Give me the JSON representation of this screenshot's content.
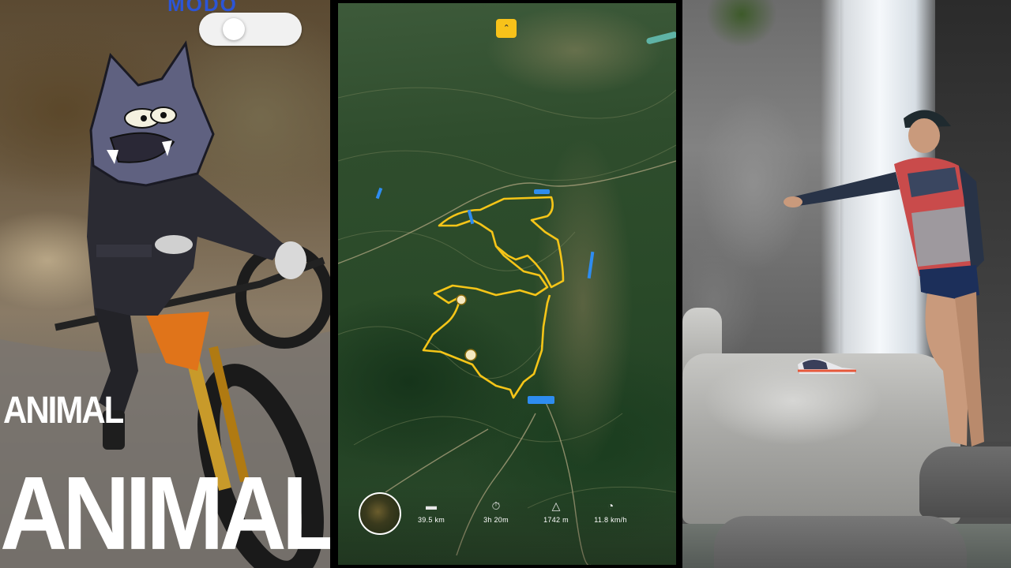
{
  "left_panel": {
    "top_text": "MODO",
    "caption_small": "ANIMAL",
    "caption_large": "ANIMAL"
  },
  "map_panel": {
    "top_icon": "chevron-up-icon",
    "stats": [
      {
        "icon": "ruler-icon",
        "value": "39.5 km"
      },
      {
        "icon": "stopwatch-icon",
        "value": "3h 20m"
      },
      {
        "icon": "mountain-icon",
        "value": "1742 m"
      },
      {
        "icon": "speedometer-icon",
        "value": "11.8 km/h"
      }
    ],
    "route_color": "#f5c518",
    "marker_color": "#2e8cf0"
  }
}
